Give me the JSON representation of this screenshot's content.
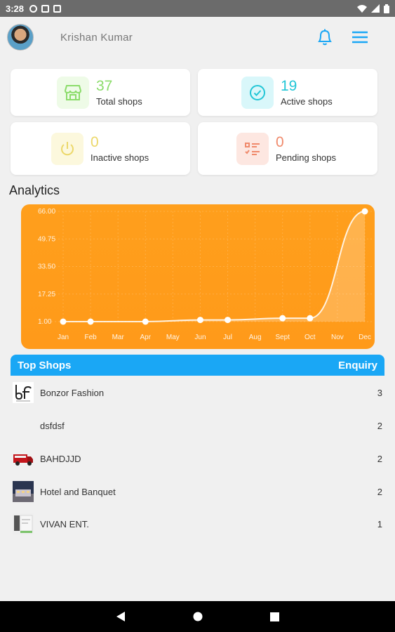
{
  "status_bar": {
    "time": "3:28"
  },
  "header": {
    "user_name": "Krishan Kumar"
  },
  "stats": [
    {
      "value": "37",
      "label": "Total shops",
      "color": "#8bdc6a",
      "bg": "#eefbe7",
      "icon": "store-icon"
    },
    {
      "value": "19",
      "label": "Active shops",
      "color": "#22c6d6",
      "bg": "#d9f7fa",
      "icon": "check-circle-icon"
    },
    {
      "value": "0",
      "label": "Inactive shops",
      "color": "#ecd86a",
      "bg": "#fcf8dd",
      "icon": "power-icon"
    },
    {
      "value": "0",
      "label": "Pending shops",
      "color": "#f08a6c",
      "bg": "#fde7e1",
      "icon": "list-icon"
    }
  ],
  "analytics": {
    "title": "Analytics"
  },
  "chart_data": {
    "type": "area",
    "categories": [
      "Jan",
      "Feb",
      "Mar",
      "Apr",
      "May",
      "Jun",
      "Jul",
      "Aug",
      "Sept",
      "Oct",
      "Nov",
      "Dec"
    ],
    "yticks": [
      "1.00",
      "17.25",
      "33.50",
      "49.75",
      "66.00"
    ],
    "ylim": [
      1,
      66
    ],
    "points": [
      {
        "label": "Jan",
        "value": 1
      },
      {
        "label": "Feb",
        "value": 1
      },
      {
        "label": "Apr",
        "value": 1
      },
      {
        "label": "Jun",
        "value": 2
      },
      {
        "label": "Jul",
        "value": 2
      },
      {
        "label": "Sept",
        "value": 3
      },
      {
        "label": "Oct",
        "value": 3
      },
      {
        "label": "Dec",
        "value": 66
      }
    ],
    "grid": true,
    "background": "#ff9f1c"
  },
  "top_shops": {
    "title": "Top Shops",
    "column_right": "Enquiry",
    "rows": [
      {
        "name": "Bonzor Fashion",
        "count": "3",
        "thumb": "bf-logo"
      },
      {
        "name": "dsfdsf",
        "count": "2",
        "thumb": ""
      },
      {
        "name": "BAHDJJD",
        "count": "2",
        "thumb": "red-truck"
      },
      {
        "name": "Hotel and Banquet",
        "count": "2",
        "thumb": "hotel-photo"
      },
      {
        "name": "VIVAN ENT.",
        "count": "1",
        "thumb": "vivan-photo"
      }
    ]
  }
}
